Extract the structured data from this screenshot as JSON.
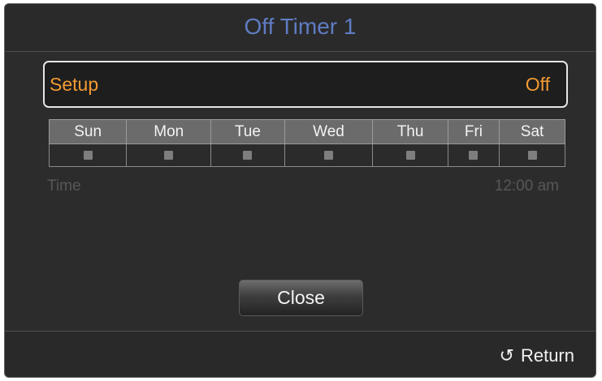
{
  "dialog": {
    "title": "Off Timer 1",
    "title_color": "#5f7cc2",
    "accent_color": "#f29a33"
  },
  "setup": {
    "label": "Setup",
    "value": "Off"
  },
  "days": [
    {
      "label": "Sun",
      "checked": false
    },
    {
      "label": "Mon",
      "checked": false
    },
    {
      "label": "Tue",
      "checked": false
    },
    {
      "label": "Wed",
      "checked": false
    },
    {
      "label": "Thu",
      "checked": false
    },
    {
      "label": "Fri",
      "checked": false
    },
    {
      "label": "Sat",
      "checked": false
    }
  ],
  "time": {
    "label": "Time",
    "value": "12:00 am"
  },
  "buttons": {
    "close_label": "Close"
  },
  "footer": {
    "return_label": "Return",
    "return_icon": "return-arrow-icon",
    "return_glyph": "↺"
  }
}
